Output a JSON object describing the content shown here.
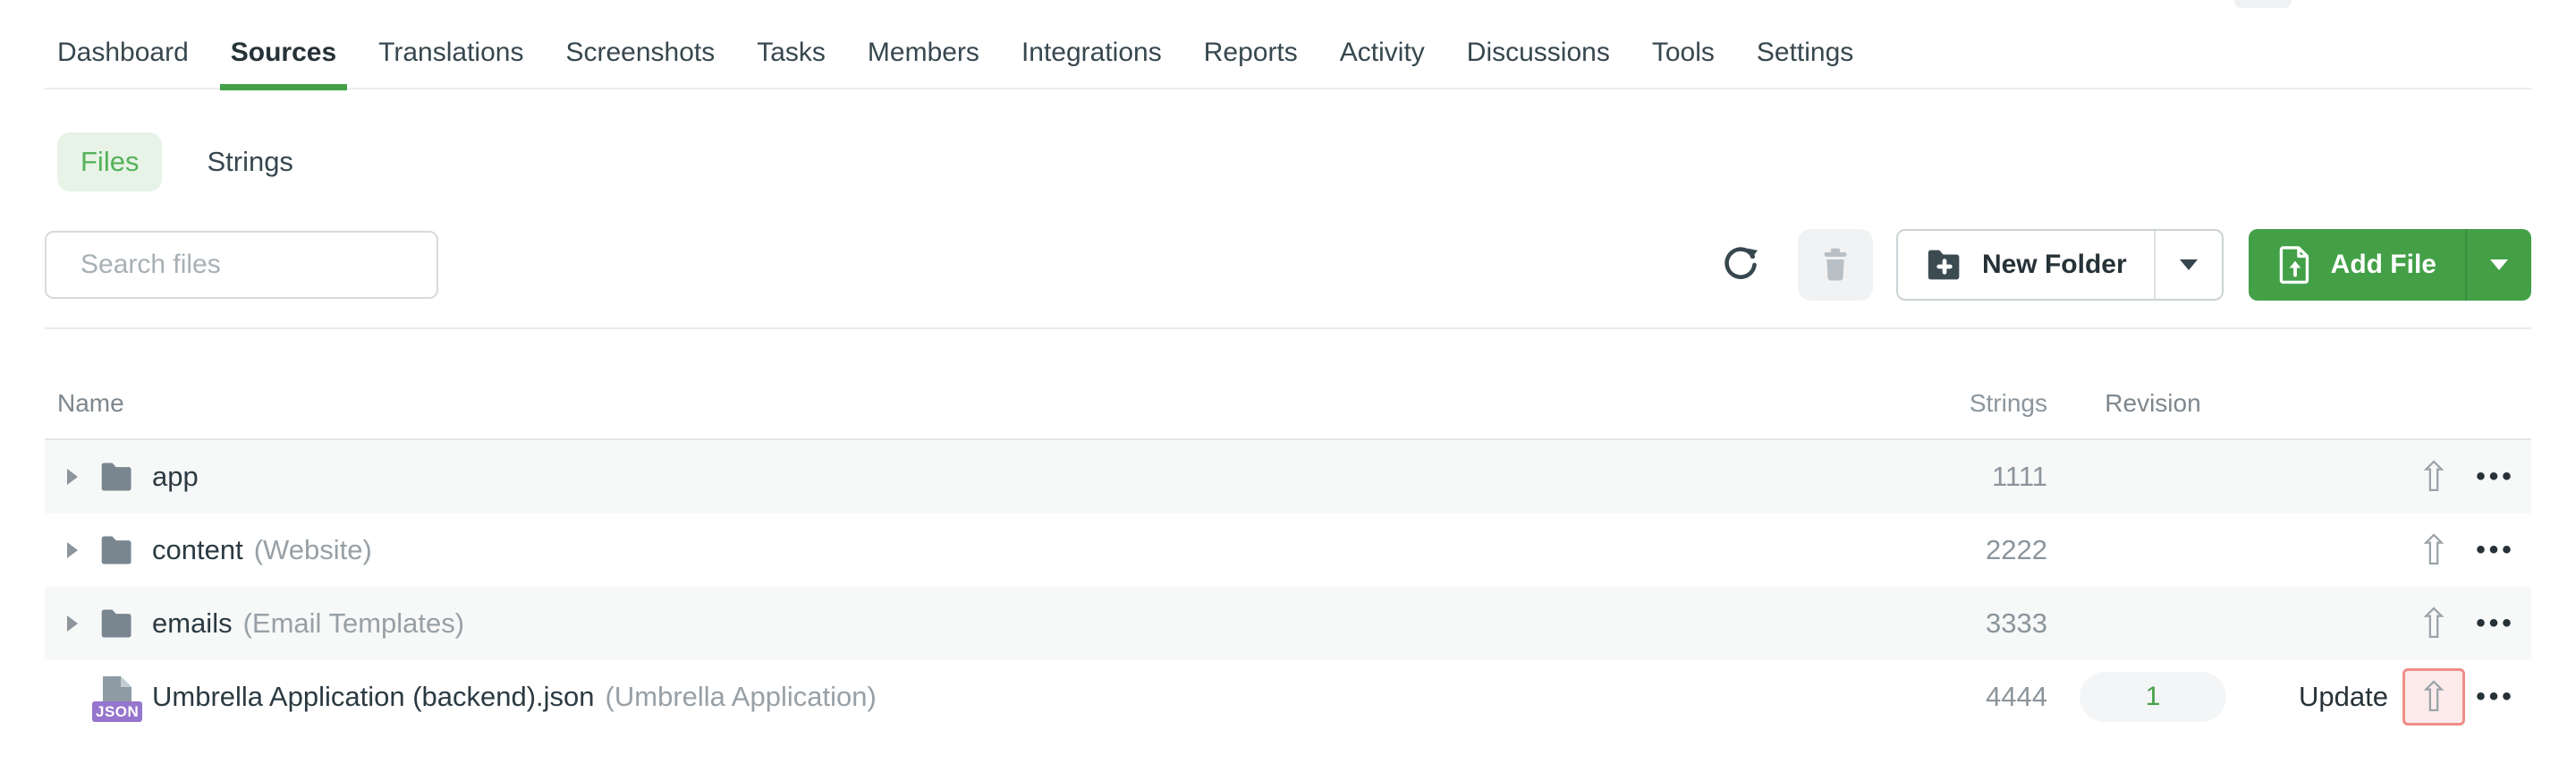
{
  "nav": {
    "items": [
      {
        "label": "Dashboard",
        "active": false
      },
      {
        "label": "Sources",
        "active": true
      },
      {
        "label": "Translations",
        "active": false
      },
      {
        "label": "Screenshots",
        "active": false
      },
      {
        "label": "Tasks",
        "active": false
      },
      {
        "label": "Members",
        "active": false
      },
      {
        "label": "Integrations",
        "active": false
      },
      {
        "label": "Reports",
        "active": false
      },
      {
        "label": "Activity",
        "active": false
      },
      {
        "label": "Discussions",
        "active": false
      },
      {
        "label": "Tools",
        "active": false
      },
      {
        "label": "Settings",
        "active": false
      }
    ]
  },
  "view_toggle": {
    "files_label": "Files",
    "strings_label": "Strings",
    "selected": "Files"
  },
  "toolbar": {
    "search_placeholder": "Search files",
    "search_value": "",
    "refresh_icon": "refresh-icon",
    "delete_icon": "trash-icon",
    "new_folder_label": "New Folder",
    "add_file_label": "Add File"
  },
  "table": {
    "headers": {
      "name": "Name",
      "strings": "Strings",
      "revision": "Revision"
    },
    "rows": [
      {
        "type": "folder",
        "name": "app",
        "suffix": "",
        "strings": "1111"
      },
      {
        "type": "folder",
        "name": "content",
        "suffix": "(Website)",
        "strings": "2222"
      },
      {
        "type": "folder",
        "name": "emails",
        "suffix": "(Email Templates)",
        "strings": "3333"
      },
      {
        "type": "file",
        "file_badge": "JSON",
        "name": "Umbrella Application (backend).json",
        "suffix": "(Umbrella Application)",
        "strings": "4444",
        "revision": "1",
        "update_label": "Update",
        "upload_highlighted": true
      }
    ]
  },
  "colors": {
    "accent_green": "#43a047",
    "light_green_bg": "#e7f3e7",
    "row_zebra": "#f7f8f8",
    "json_badge_purple": "#9575cd",
    "highlight_red_border": "#ef8e88",
    "highlight_red_bg": "#fcebea"
  }
}
